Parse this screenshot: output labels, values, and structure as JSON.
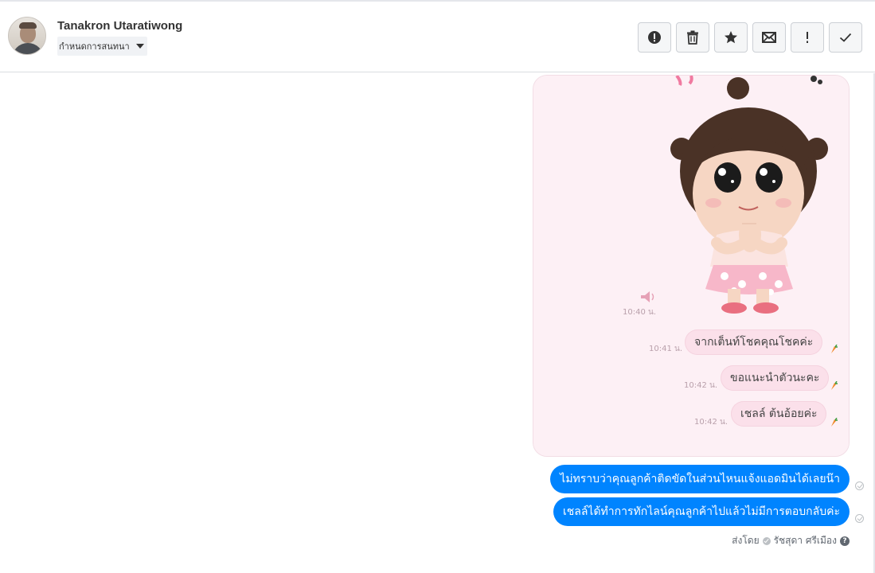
{
  "header": {
    "contact_name": "Tanakron Utaratiwong",
    "assign_label": "กำหนดการสนทนา",
    "actions": [
      {
        "icon": "alert-circle-icon",
        "label": "!"
      },
      {
        "icon": "trash-icon"
      },
      {
        "icon": "star-icon"
      },
      {
        "icon": "envelope-icon"
      },
      {
        "icon": "exclamation-icon",
        "label": "!"
      },
      {
        "icon": "checkmark-icon"
      }
    ]
  },
  "image_message": {
    "stamps": [
      "10:40 น.",
      "10:41 น.",
      "10:42 น.",
      "10:42 น."
    ],
    "bubbles": [
      "จากเต็นท์โชคคุณโชคค่ะ",
      "ขอแนะนำตัวนะคะ",
      "เชลล์ ต้นอ้อยค่ะ"
    ]
  },
  "messages": [
    {
      "text": "ไม่ทราบว่าคุณลูกค้าติดขัดในส่วนไหนแจ้งแอดมินได้เลยน๊า"
    },
    {
      "text": "เชลล์ได้ทำการทักไลน์คุณลูกค้าไปแล้วไม่มีการตอบกลับค่ะ"
    }
  ],
  "sent_by": {
    "prefix": "ส่งโดย",
    "name": "รัชสุดา ศรีเมือง",
    "help": "?"
  },
  "colors": {
    "bubble_blue": "#0084ff",
    "sticker_bg": "#fdf0f5",
    "pink_bubble": "#fbe0ea"
  }
}
